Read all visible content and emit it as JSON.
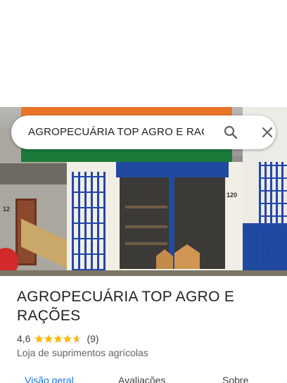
{
  "search": {
    "query": "AGROPECUÁRIA TOP AGRO E RAÇÕ"
  },
  "place": {
    "name_line1": "AGROPECUÁRIA TOP AGRO E",
    "name_line2": "RAÇÕES",
    "rating": "4,6",
    "stars": 4.6,
    "review_count": "(9)",
    "category": "Loja de suprimentos agrícolas"
  },
  "photo": {
    "number_left": "12",
    "number_right": "120"
  },
  "tabs": [
    {
      "label": "Visão geral",
      "active": true
    },
    {
      "label": "Avaliações",
      "active": false
    },
    {
      "label": "Sobre",
      "active": false
    }
  ],
  "colors": {
    "accent": "#1a73e8",
    "star": "#fbbc04"
  }
}
